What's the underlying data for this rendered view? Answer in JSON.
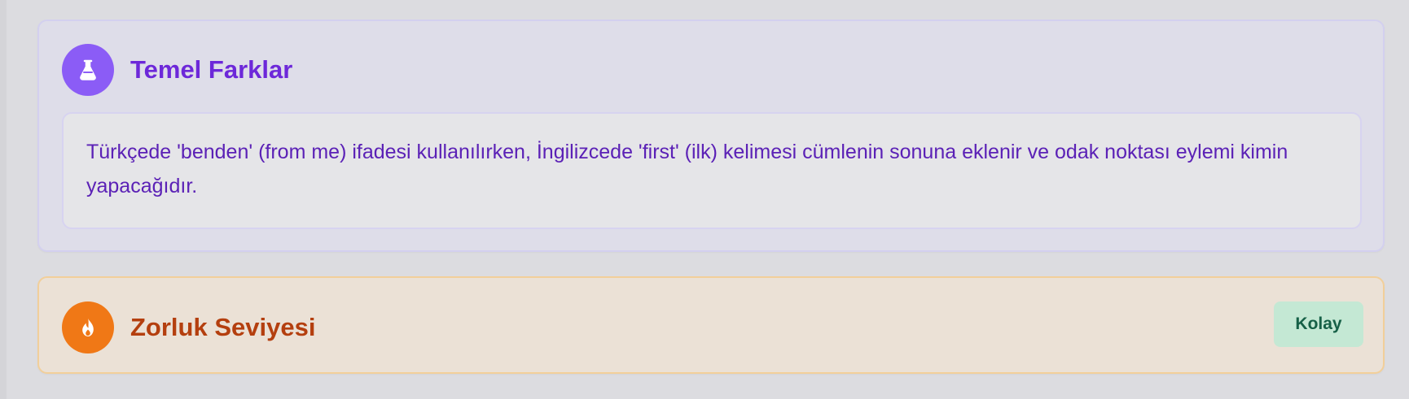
{
  "sections": {
    "differences": {
      "icon": "flask-icon",
      "title": "Temel Farklar",
      "text": "Türkçede 'benden' (from me) ifadesi kullanılırken, İngilizcede 'first' (ilk) kelimesi cümlenin sonuna eklenir ve odak noktası eylemi kimin yapacağıdır.",
      "accent_color": "#8b5cf6",
      "title_color": "#6d28d9"
    },
    "difficulty": {
      "icon": "fire-icon",
      "title": "Zorluk Seviyesi",
      "badge": "Kolay",
      "accent_color": "#f07816",
      "title_color": "#b43f0f",
      "badge_color": "#c4e8d4"
    }
  }
}
